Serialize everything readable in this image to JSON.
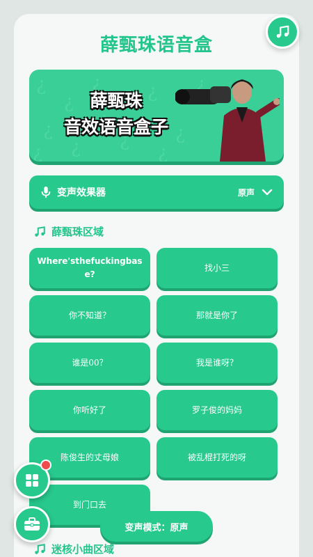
{
  "app": {
    "title": "薛甄珠语音盒"
  },
  "banner": {
    "line1": "薛甄珠",
    "line2": "音效语音盒子"
  },
  "voice_effect": {
    "label": "变声效果器",
    "selected": "原声"
  },
  "section_xue": {
    "title": "薛甄珠区域",
    "buttons": [
      "Where'sthefuckingbase?",
      "找小三",
      "你不知道？",
      "那就是你了",
      "谁是00？",
      "我是谁呀？",
      "你听好了",
      "罗子俊的妈妈",
      "陈俊生的丈母娘",
      "被乱棍打死的呀",
      "到门口去"
    ]
  },
  "section_mini": {
    "title": "迷核小曲区域"
  },
  "mode_pill": {
    "label": "变声模式：原声"
  },
  "icons": {
    "music": "music-note-icon",
    "mic": "microphone-icon",
    "chevron": "chevron-down-icon",
    "grid": "grid-icon",
    "toolbox": "toolbox-icon"
  },
  "colors": {
    "accent": "#27c98d",
    "accent_dark": "#1ea371",
    "title": "#22c58b",
    "badge": "#f04b4b"
  }
}
